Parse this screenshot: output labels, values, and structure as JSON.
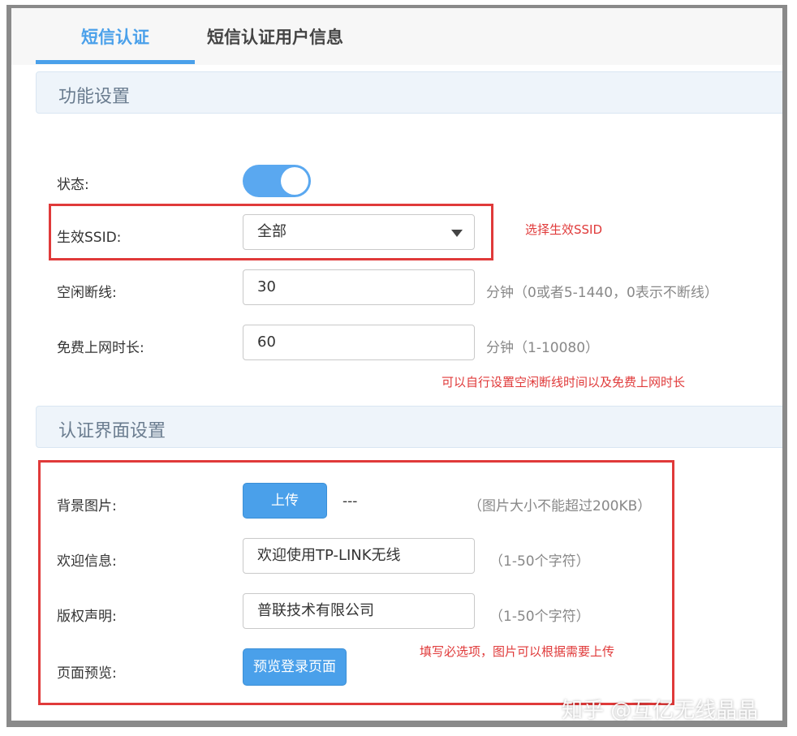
{
  "tabs": [
    {
      "label": "短信认证",
      "active": true
    },
    {
      "label": "短信认证用户信息",
      "active": false
    }
  ],
  "section1": {
    "title": "功能设置"
  },
  "status": {
    "label": "状态:",
    "enabled": true
  },
  "ssid": {
    "label": "生效SSID:",
    "value": "全部",
    "annotation": "选择生效SSID"
  },
  "idle": {
    "label": "空闲断线:",
    "value": "30",
    "hint": "分钟（0或者5-1440，0表示不断线）"
  },
  "free": {
    "label": "免费上网时长:",
    "value": "60",
    "hint": "分钟（1-10080）"
  },
  "annotation_time": "可以自行设置空闲断线时间以及免费上网时长",
  "section2": {
    "title": "认证界面设置"
  },
  "background": {
    "label": "背景图片:",
    "button": "上传",
    "value": "---",
    "hint": "（图片大小不能超过200KB）"
  },
  "welcome": {
    "label": "欢迎信息:",
    "value": "欢迎使用TP-LINK无线",
    "hint": "（1-50个字符）"
  },
  "copyright": {
    "label": "版权声明:",
    "value": "普联技术有限公司",
    "hint": "（1-50个字符）"
  },
  "preview": {
    "label": "页面预览:",
    "button": "预览登录页面"
  },
  "annotation_required": "填写必选项，图片可以根据需要上传",
  "watermark": "知乎 @互亿无线晶晶",
  "colors": {
    "accent": "#4aa0ea",
    "annotation": "#e03a3a"
  }
}
